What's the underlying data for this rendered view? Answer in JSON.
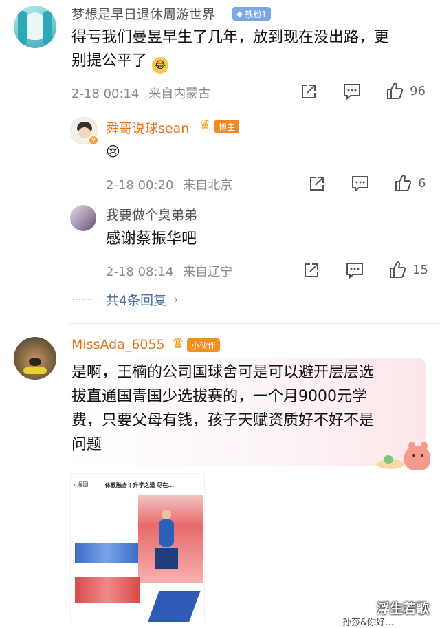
{
  "comments": [
    {
      "username": "梦想是早日退休周游世界",
      "badge": "铁粉1",
      "text_line1": "得亏我们曼昱早生了几年，放到现在没出路，更",
      "text_line2": "别提公平了",
      "date": "2-18 00:14",
      "location": "来自内蒙古",
      "likes": "96",
      "replies": [
        {
          "username": "舜哥说球sean",
          "badge": "博主",
          "emoji": "😢",
          "date": "2-18 00:20",
          "location": "来自北京",
          "likes": "6"
        },
        {
          "username": "我要做个臭弟弟",
          "text": "感谢蔡振华吧",
          "date": "2-18 08:14",
          "location": "来自辽宁",
          "likes": "15"
        }
      ],
      "more_replies": "共4条回复",
      "dots": "……"
    },
    {
      "username": "MissAda_6055",
      "badge": "小伙伴",
      "text_line1": "是啊，王楠的公司国球舍可是可以避开层层选",
      "text_line2": "拔直通国青国少选拔赛的，一个月9000元学",
      "text_line3": "费，只要父母有钱，孩子天赋资质好不好不是",
      "text_line4": "问题",
      "image": {
        "back_label": "返回",
        "title": "体教融合 | 升学之道 尽在..."
      }
    }
  ],
  "watermark": "浮生若歌",
  "bottom_cut_text": "孙莎&你好..."
}
